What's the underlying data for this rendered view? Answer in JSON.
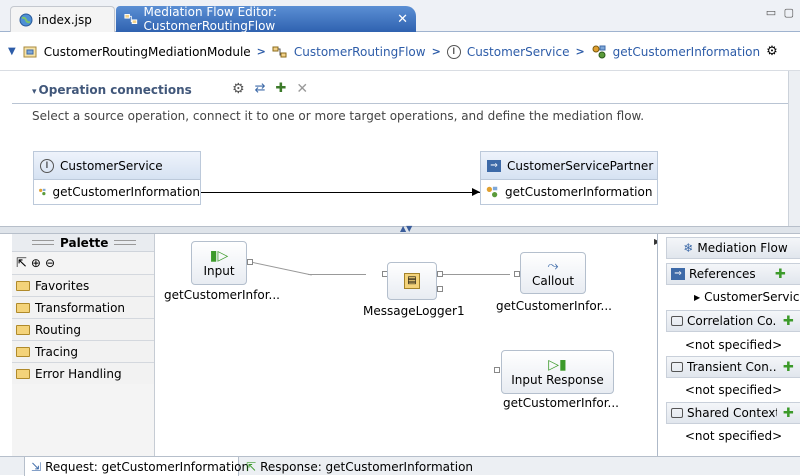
{
  "colors": {
    "accent": "#2f62b0",
    "link": "#2d5ca8",
    "add_green": "#3c9a2a"
  },
  "tabs": [
    {
      "label": "index.jsp",
      "icon": "globe-icon"
    },
    {
      "label": "Mediation Flow Editor: CustomerRoutingFlow",
      "icon": "flow-icon",
      "close": "✕"
    }
  ],
  "breadcrumb": [
    {
      "label": "CustomerRoutingMediationModule",
      "icon": "module-icon"
    },
    {
      "label": "CustomerRoutingFlow",
      "icon": "flow-icon"
    },
    {
      "label": "CustomerService",
      "icon": "interface-icon"
    },
    {
      "label": "getCustomerInformation",
      "icon": "operation-icon"
    }
  ],
  "operation_connections": {
    "title": "Operation connections",
    "description": "Select a source operation, connect it to one or more target operations, and define the mediation flow.",
    "source": {
      "name": "CustomerService",
      "badge": "I",
      "operation": "getCustomerInformation"
    },
    "target": {
      "name": "CustomerServicePartner",
      "operation": "getCustomerInformation"
    }
  },
  "palette": {
    "title": "Palette",
    "drawers": [
      "Favorites",
      "Transformation",
      "Routing",
      "Tracing",
      "Error Handling"
    ]
  },
  "canvas": {
    "input": {
      "label": "Input",
      "caption": "getCustomerInfor..."
    },
    "logger": {
      "caption": "MessageLogger1"
    },
    "callout": {
      "label": "Callout",
      "caption": "getCustomerInfor..."
    },
    "input_response": {
      "label": "Input Response",
      "caption": "getCustomerInfor..."
    }
  },
  "right_panel": {
    "title": "Mediation Flow",
    "references": {
      "label": "References",
      "child": "CustomerServiceP"
    },
    "correlation": {
      "label": "Correlation Co...",
      "value": "<not specified>"
    },
    "transient": {
      "label": "Transient Con...",
      "value": "<not specified>"
    },
    "shared": {
      "label": "Shared Context",
      "value": "<not specified>"
    }
  },
  "bottom_tabs": [
    {
      "label": "Request: getCustomerInformation"
    },
    {
      "label": "Response: getCustomerInformation"
    }
  ]
}
